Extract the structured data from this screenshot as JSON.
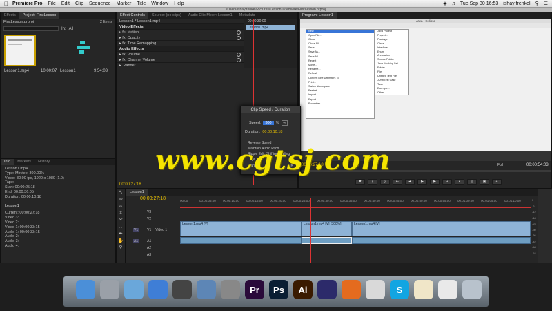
{
  "menubar": {
    "app": "Premiere Pro",
    "items": [
      "File",
      "Edit",
      "Clip",
      "Sequence",
      "Marker",
      "Title",
      "Window",
      "Help"
    ],
    "clock": "Tue Sep 30  16:53",
    "user": "ishay frenkel"
  },
  "titlebar": "/Users/ishayfrenkel/Pictures/Lesson1Premiere/FirstLesson.prproj",
  "project": {
    "tabs": [
      "Effects",
      "Project: FirstLesson"
    ],
    "file": "FirstLesson.prproj",
    "count": "2 Items",
    "in_label": "In:",
    "in_value": "All",
    "items": [
      {
        "name": "Lesson1.mp4",
        "duration": "10:00:07"
      },
      {
        "name": "Lesson1",
        "duration": "9:54:03"
      }
    ]
  },
  "effect_controls": {
    "tabs": [
      "Effect Controls",
      "Source: (no clips)",
      "Audio Clip Mixer: Lesson1",
      "Metadata"
    ],
    "clip": "Lesson1 * Lesson1.mp4",
    "timecode": "00:00:30:00",
    "clip_label": "Lesson1.mp4",
    "video_header": "Video Effects",
    "video_rows": [
      "Motion",
      "Opacity",
      "Time Remapping"
    ],
    "audio_header": "Audio Effects",
    "audio_rows": [
      "Volume",
      "Channel Volume",
      "Panner"
    ],
    "current_time": "00:00:27:18"
  },
  "info": {
    "tabs": [
      "Info",
      "Markers",
      "History"
    ],
    "lines": [
      "Lesson1.mp4",
      "Type: Movie x 300.00%",
      "Video: 30.00 fps, 1920 x 1080 (1.0)",
      "",
      "Tape:",
      "Start: 00:00:25:18",
      "End: 00:00:36:05",
      "Duration: 00:00:10:18"
    ],
    "seq": "Lesson1",
    "seq_lines": [
      "Current: 00:00:27:18",
      "Video 3:",
      "Video 2:",
      "Video 1: 00:00:33:15",
      "Audio 1: 00:00:33:15",
      "Audio 2:",
      "Audio 3:",
      "Audio 4:"
    ]
  },
  "program": {
    "tab": "Program: Lesson1",
    "timecode_left": "00:00:27:18",
    "fit": "Full",
    "timecode_right": "00:00:54:03",
    "inner_title": "Java - Eclipse",
    "menu_items": [
      "New",
      "Open File...",
      "Close",
      "Close All",
      "Save",
      "Save As...",
      "Save All",
      "Revert",
      "Move...",
      "Rename...",
      "Refresh",
      "Convert Line Delimiters To",
      "Print...",
      "Switch Workspace",
      "Restart",
      "Import...",
      "Export...",
      "Properties"
    ],
    "submenu": [
      "Java Project",
      "Project...",
      "Package",
      "Class",
      "Interface",
      "Enum",
      "Annotation",
      "Source Folder",
      "Java Working Set",
      "Folder",
      "File",
      "Untitled Text File",
      "JUnit Test Case",
      "Task",
      "Example...",
      "Other..."
    ]
  },
  "dialog": {
    "title": "Clip Speed / Duration",
    "speed_label": "Speed:",
    "speed_value": "300",
    "speed_unit": "%",
    "duration_label": "Duration:",
    "duration_value": "00:00:10:18",
    "checks": [
      "Reverse Speed",
      "Maintain Audio Pitch",
      "Ripple Edit, Shifting Trailing Clips"
    ],
    "cancel": "Cancel",
    "ok": "OK"
  },
  "timeline": {
    "tab": "Lesson1",
    "timecode": "00:00:27:18",
    "ruler": [
      "00:00",
      "00:00:05:00",
      "00:00:10:00",
      "00:00:15:00",
      "00:00:20:00",
      "00:00:25:00",
      "00:00:30:00",
      "00:00:35:00",
      "00:00:40:00",
      "00:00:45:00",
      "00:00:50:00",
      "00:00:55:00",
      "00:01:00:00",
      "00:01:05:00",
      "00:01:10:00"
    ],
    "tracks": [
      "V3",
      "V2",
      "V1",
      "A1",
      "A2",
      "A3"
    ],
    "track_name": "Video 1",
    "clips": [
      "Lesson1.mp4 [V]",
      "Lesson1.mp4 [V] [300%]",
      "Lesson1.mp4 [V]"
    ],
    "meter": [
      "0",
      "-6",
      "-12",
      "-18",
      "-24",
      "-30",
      "-36",
      "-42",
      "-48",
      "-54"
    ]
  },
  "watermark": "www.cgtsj.com",
  "dock": [
    {
      "icon": "finder-icon",
      "label": "",
      "color": "#4b8fd8"
    },
    {
      "icon": "rocket-icon",
      "label": "",
      "color": "#9aa0a8"
    },
    {
      "icon": "mail-icon",
      "label": "",
      "color": "#6aa7da"
    },
    {
      "icon": "itunes-icon",
      "label": "",
      "color": "#3f7ed6"
    },
    {
      "icon": "film-icon",
      "label": "",
      "color": "#444"
    },
    {
      "icon": "preview-icon",
      "label": "",
      "color": "#5d86b6"
    },
    {
      "icon": "system-prefs-icon",
      "label": "",
      "color": "#888"
    },
    {
      "icon": "premiere-icon",
      "label": "Pr",
      "color": "#2a0a3a"
    },
    {
      "icon": "photoshop-icon",
      "label": "Ps",
      "color": "#0a1e33"
    },
    {
      "icon": "illustrator-icon",
      "label": "Ai",
      "color": "#3a1a00"
    },
    {
      "icon": "eclipse-icon",
      "label": "",
      "color": "#2c2a6a"
    },
    {
      "icon": "firefox-icon",
      "label": "",
      "color": "#e46b1f"
    },
    {
      "icon": "chrome-icon",
      "label": "",
      "color": "#d9d9d9"
    },
    {
      "icon": "skype-icon",
      "label": "S",
      "color": "#12a5e2"
    },
    {
      "icon": "textedit-icon",
      "label": "",
      "color": "#f0e6c8"
    },
    {
      "icon": "notes-icon",
      "label": "",
      "color": "#e9e9e9"
    },
    {
      "icon": "trash-icon",
      "label": "",
      "color": "#b8c2cc"
    }
  ]
}
